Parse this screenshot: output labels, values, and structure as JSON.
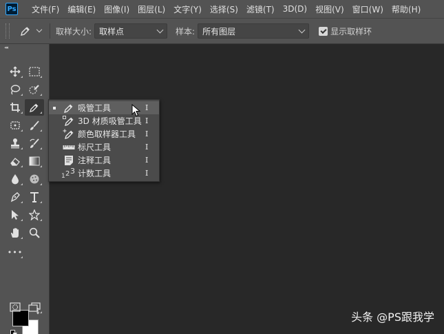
{
  "app": {
    "logo_text": "Ps"
  },
  "menubar": {
    "items": [
      "文件(F)",
      "编辑(E)",
      "图像(I)",
      "图层(L)",
      "文字(Y)",
      "选择(S)",
      "滤镜(T)",
      "3D(D)",
      "视图(V)",
      "窗口(W)",
      "帮助(H)"
    ]
  },
  "options_bar": {
    "tool_icon": "eyedropper-icon",
    "sample_size_label": "取样大小:",
    "sample_size_value": "取样点",
    "sample_label": "样本:",
    "sample_value": "所有图层",
    "show_ring_label": "显示取样环",
    "show_ring_checked": true
  },
  "toolbar": {
    "collapse_glyph": "◂◂",
    "tools": [
      [
        "move-icon",
        "marquee-icon"
      ],
      [
        "lasso-icon",
        "quick-select-icon"
      ],
      [
        "crop-icon",
        "eyedropper-icon"
      ],
      [
        "healing-icon",
        "brush-icon"
      ],
      [
        "stamp-icon",
        "history-brush-icon"
      ],
      [
        "eraser-icon",
        "gradient-icon"
      ],
      [
        "blur-icon",
        "sponge-icon"
      ],
      [
        "pen-icon",
        "type-icon"
      ],
      [
        "path-select-icon",
        "shape-icon"
      ],
      [
        "hand-icon",
        "zoom-icon"
      ]
    ],
    "more_glyph": "•••",
    "foreground_color": "#000000",
    "background_color": "#ffffff"
  },
  "flyout": {
    "items": [
      {
        "label": "吸管工具",
        "shortcut": "I",
        "icon": "eyedropper-icon",
        "active": true
      },
      {
        "label": "3D 材质吸管工具",
        "shortcut": "I",
        "icon": "3d-eyedropper-icon",
        "active": false
      },
      {
        "label": "颜色取样器工具",
        "shortcut": "I",
        "icon": "color-sampler-icon",
        "active": false
      },
      {
        "label": "标尺工具",
        "shortcut": "I",
        "icon": "ruler-icon",
        "active": false
      },
      {
        "label": "注释工具",
        "shortcut": "I",
        "icon": "note-icon",
        "active": false
      },
      {
        "label": "计数工具",
        "shortcut": "I",
        "icon": "count-icon",
        "active": false
      }
    ]
  },
  "watermark": {
    "text": "头条 @PS跟我学"
  },
  "colors": {
    "menubar_bg": "#535353",
    "canvas_bg": "#282828",
    "flyout_bg": "#4b4b4b"
  }
}
